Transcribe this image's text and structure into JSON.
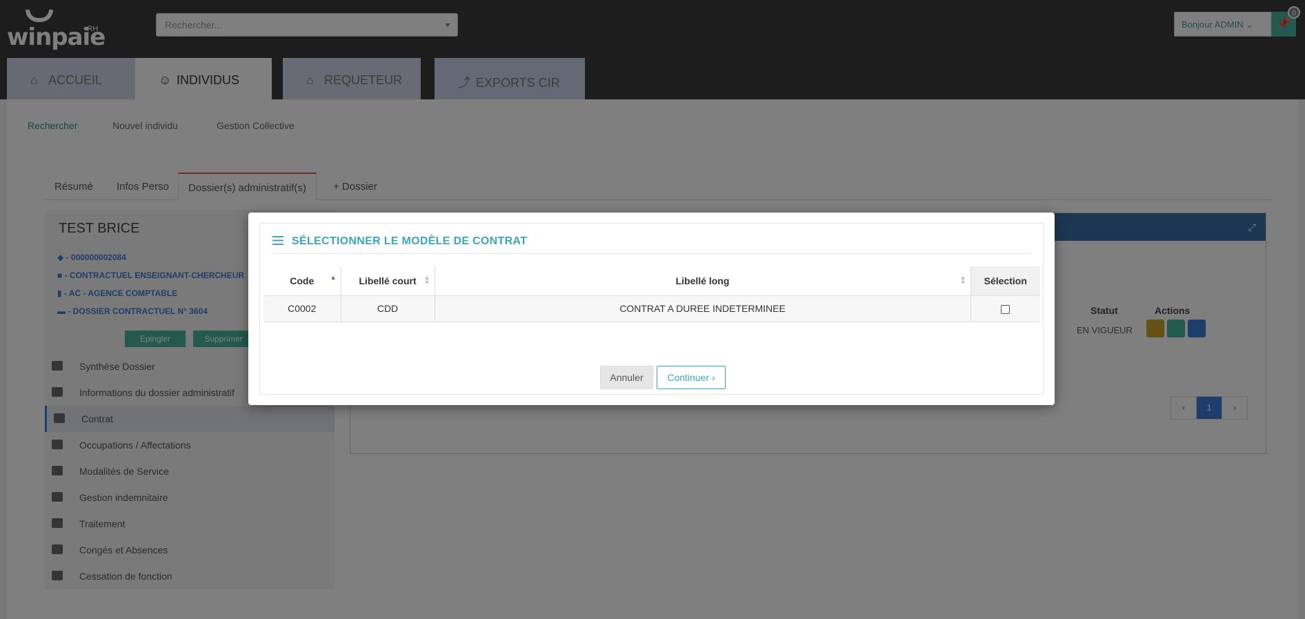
{
  "brand": {
    "name": "winpaie",
    "suffix": "+RH"
  },
  "search": {
    "placeholder": "Rechercher..."
  },
  "user_menu": {
    "greeting": "Bonjour ADMIN"
  },
  "pin": {
    "count": "0"
  },
  "main_tabs": [
    {
      "label": "ACCUEIL"
    },
    {
      "label": "INDIVIDUS"
    },
    {
      "label": "REQUETEUR"
    },
    {
      "label": "EXPORTS CIR"
    }
  ],
  "sub_nav": [
    "Rechercher",
    "Nouvel individu",
    "Gestion Collective"
  ],
  "file_tabs": [
    "Résumé",
    "Infos Perso",
    "Dossier(s) administratif(s)",
    "+ Dossier"
  ],
  "person": {
    "name": "TEST BRICE",
    "id": "- 000000002084",
    "category": "- CONTRACTUEL ENSEIGNANT-CHERCHEUR",
    "agency": "- AC - AGENCE COMPTABLE",
    "dossier": "- DOSSIER CONTRACTUEL N° 3604"
  },
  "left_buttons": [
    "Epingler",
    "Supprimer"
  ],
  "left_menu": [
    "Synthèse Dossier",
    "Informations du dossier administratif",
    "Contrat",
    "Occupations / Affectations",
    "Modalités de Service",
    "Gestion indemnitaire",
    "Traitement",
    "Congés et Absences",
    "Cessation de fonction"
  ],
  "right_table": {
    "headers": [
      "Statut",
      "Actions"
    ],
    "status": "EN VIGUEUR",
    "page": "1",
    "prev": "‹",
    "next": "›"
  },
  "modal": {
    "title": "SÉLECTIONNER LE MODÈLE DE CONTRAT",
    "headers": [
      "Code",
      "Libellé court",
      "Libellé long",
      "Sélection"
    ],
    "rows": [
      {
        "code": "C0002",
        "court": "CDD",
        "long": "CONTRAT A DUREE INDETERMINEE"
      }
    ],
    "cancel": "Annuler",
    "continue": "Continuer ›"
  },
  "colors": {
    "accent": "#3aa6b9",
    "primary": "#3a7bd5",
    "danger": "#d9534f",
    "success": "#47b39c"
  }
}
